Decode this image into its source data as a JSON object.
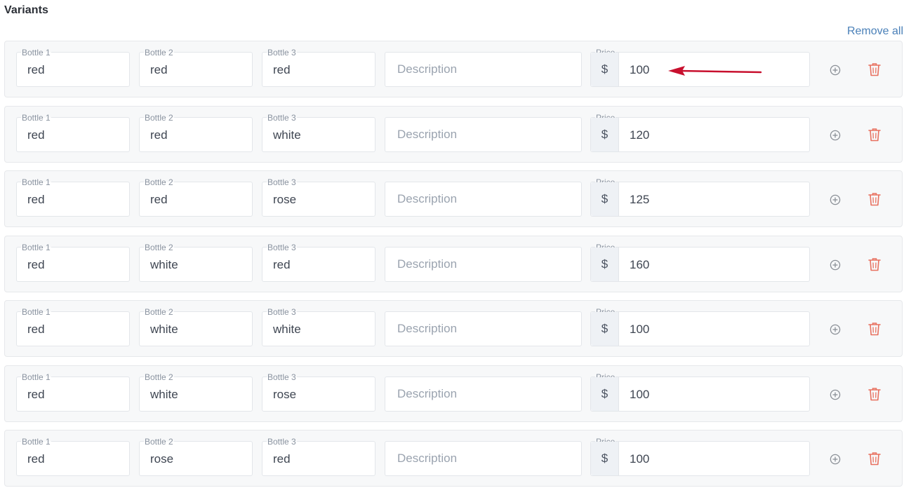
{
  "section": {
    "title": "Variants",
    "remove_all_label": "Remove all"
  },
  "labels": {
    "bottle1": "Bottle 1",
    "bottle2": "Bottle 2",
    "bottle3": "Bottle 3",
    "price": "Price",
    "description_placeholder": "Description",
    "currency": "$"
  },
  "variants": [
    {
      "bottle1": "red",
      "bottle2": "red",
      "bottle3": "red",
      "price": "100"
    },
    {
      "bottle1": "red",
      "bottle2": "red",
      "bottle3": "white",
      "price": "120"
    },
    {
      "bottle1": "red",
      "bottle2": "red",
      "bottle3": "rose",
      "price": "125"
    },
    {
      "bottle1": "red",
      "bottle2": "white",
      "bottle3": "red",
      "price": "160"
    },
    {
      "bottle1": "red",
      "bottle2": "white",
      "bottle3": "white",
      "price": "100"
    },
    {
      "bottle1": "red",
      "bottle2": "white",
      "bottle3": "rose",
      "price": "100"
    },
    {
      "bottle1": "red",
      "bottle2": "rose",
      "bottle3": "red",
      "price": "100"
    }
  ],
  "icons": {
    "add": "plus-circle-icon",
    "delete": "trash-icon",
    "annotation": "arrow-annotation"
  },
  "colors": {
    "link": "#4a80b8",
    "delete": "#e8705f",
    "arrow": "#c8102e"
  }
}
